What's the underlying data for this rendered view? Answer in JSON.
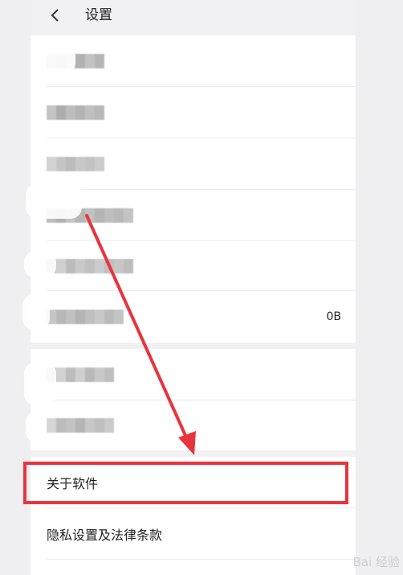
{
  "header": {
    "title": "设置",
    "back_icon": "chevron-left-icon"
  },
  "rows": [
    {
      "label_redacted": true,
      "value": ""
    },
    {
      "label_redacted": true,
      "value": ""
    },
    {
      "label_redacted": true,
      "value": ""
    },
    {
      "label_redacted": true,
      "value": ""
    },
    {
      "label_redacted": true,
      "value": ""
    },
    {
      "label_redacted": true,
      "value": "0B"
    },
    {
      "label_redacted": true,
      "value": ""
    },
    {
      "label_redacted": true,
      "value": ""
    }
  ],
  "highlighted_row": {
    "label": "关于软件"
  },
  "privacy_row": {
    "label": "隐私设置及法律条款"
  },
  "annotation": {
    "color": "#e8343d"
  },
  "watermark": {
    "text": "Bai 经验"
  }
}
